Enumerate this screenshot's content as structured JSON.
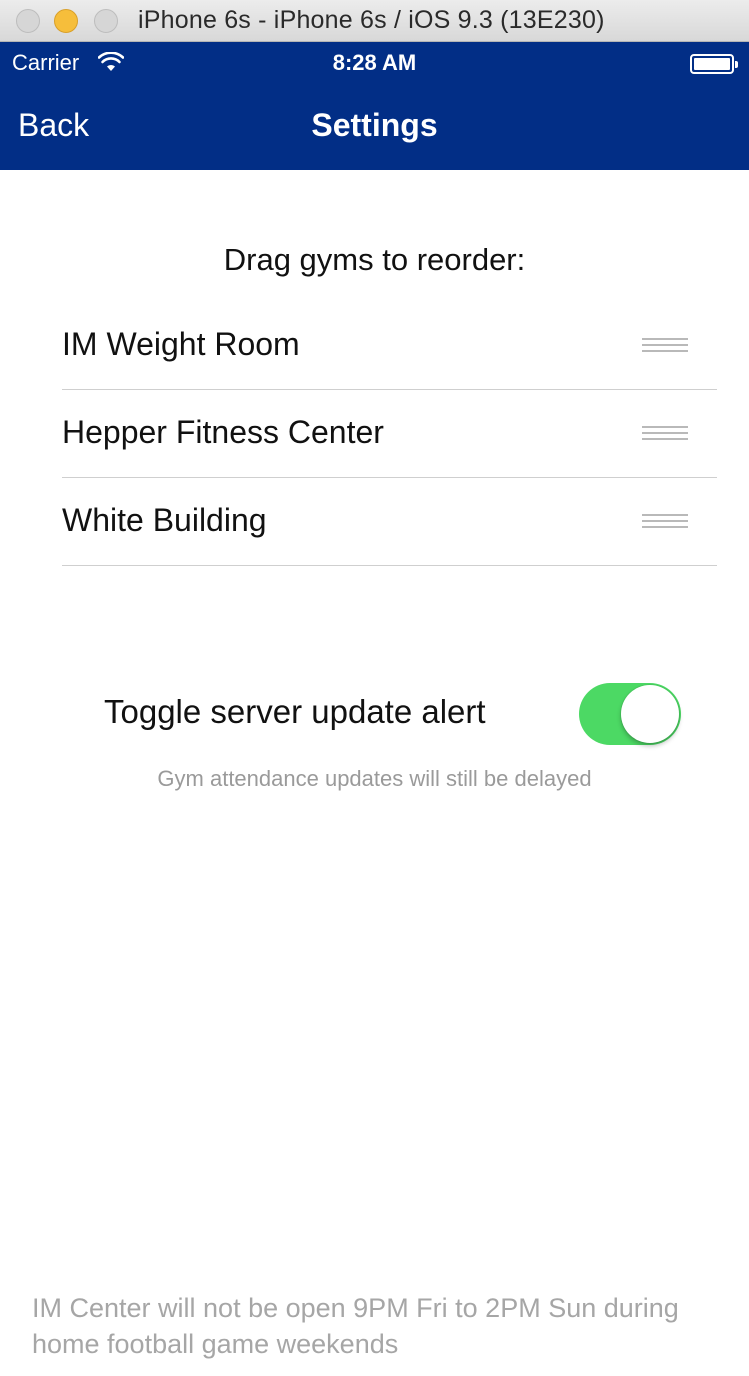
{
  "window": {
    "title": "iPhone 6s - iPhone 6s / iOS 9.3 (13E230)"
  },
  "status_bar": {
    "carrier": "Carrier",
    "time": "8:28 AM",
    "battery_level_percent": 100,
    "wifi_icon": "wifi-icon",
    "background_color": "#022e86"
  },
  "nav_bar": {
    "back_label": "Back",
    "title": "Settings"
  },
  "gyms_section": {
    "header": "Drag gyms to reorder:",
    "items": [
      {
        "label": "IM Weight Room"
      },
      {
        "label": "Hepper Fitness Center"
      },
      {
        "label": "White Building"
      }
    ],
    "drag_icon": "drag-handle-icon"
  },
  "alert_setting": {
    "label": "Toggle server update alert",
    "enabled": true,
    "toggle_color": "#4cd964",
    "subtitle": "Gym attendance updates will still be delayed"
  },
  "footer": {
    "note": "IM Center will not be open 9PM Fri to 2PM Sun during home football game weekends"
  }
}
